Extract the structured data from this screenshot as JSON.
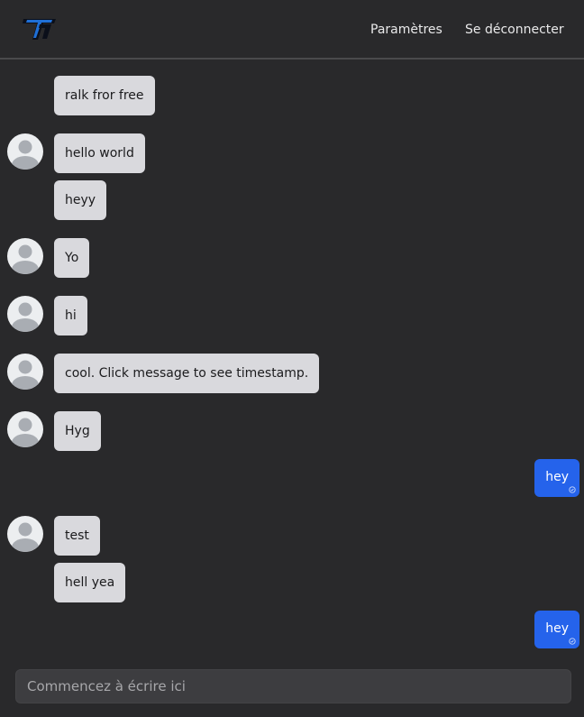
{
  "navbar": {
    "logo_icon": "tt-logo",
    "settings_label": "Paramètres",
    "logout_label": "Se déconnecter"
  },
  "messages": [
    {
      "text": "ralk fror free",
      "mine": false,
      "avatar": false
    },
    {
      "text": "hello world",
      "mine": false,
      "avatar": true
    },
    {
      "text": "heyy",
      "mine": false,
      "avatar": false
    },
    {
      "text": "Yo",
      "mine": false,
      "avatar": true
    },
    {
      "text": "hi",
      "mine": false,
      "avatar": true
    },
    {
      "text": "cool. Click message to see timestamp.",
      "mine": false,
      "avatar": true
    },
    {
      "text": "Hyg",
      "mine": false,
      "avatar": true
    },
    {
      "text": "hey",
      "mine": true,
      "avatar": false
    },
    {
      "text": "test",
      "mine": false,
      "avatar": true
    },
    {
      "text": "hell yea",
      "mine": false,
      "avatar": false
    },
    {
      "text": "hey",
      "mine": true,
      "avatar": false
    }
  ],
  "composer": {
    "placeholder": "Commencez à écrire ici"
  },
  "colors": {
    "background": "#29292b",
    "bubble_other": "#d9d9dd",
    "bubble_mine": "#2563eb"
  }
}
